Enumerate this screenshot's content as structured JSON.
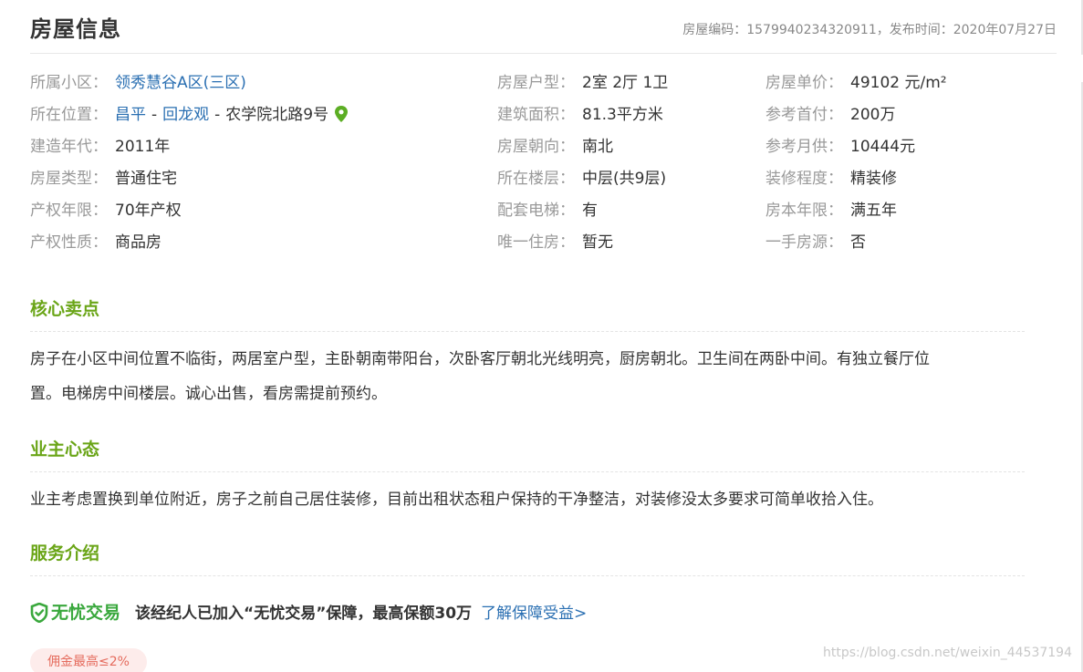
{
  "header": {
    "title": "房屋信息",
    "code_label": "房屋编码：",
    "code_value": "1579940234320911",
    "separator": "，",
    "publish_label": "发布时间：",
    "publish_value": "2020年07月27日"
  },
  "info": {
    "community": {
      "label": "所属小区：",
      "value": "领秀慧谷A区(三区)"
    },
    "location": {
      "label": "所在位置：",
      "district": "昌平",
      "area": "回龙观",
      "dash": "-",
      "address": "农学院北路9号"
    },
    "build_year": {
      "label": "建造年代：",
      "value": "2011年"
    },
    "house_type": {
      "label": "房屋类型：",
      "value": "普通住宅"
    },
    "property_term": {
      "label": "产权年限：",
      "value": "70年产权"
    },
    "property_nature": {
      "label": "产权性质：",
      "value": "商品房"
    },
    "layout": {
      "label": "房屋户型：",
      "value": "2室 2厅 1卫"
    },
    "area_size": {
      "label": "建筑面积：",
      "value": "81.3平方米"
    },
    "orientation": {
      "label": "房屋朝向：",
      "value": "南北"
    },
    "floor": {
      "label": "所在楼层：",
      "value": "中层(共9层)"
    },
    "elevator": {
      "label": "配套电梯：",
      "value": "有"
    },
    "only_house": {
      "label": "唯一住房：",
      "value": "暂无"
    },
    "unit_price": {
      "label": "房屋单价：",
      "value": "49102 元/m²"
    },
    "down_payment": {
      "label": "参考首付：",
      "value": "200万"
    },
    "monthly_payment": {
      "label": "参考月供：",
      "value": "10444元"
    },
    "decoration": {
      "label": "装修程度：",
      "value": "精装修"
    },
    "ownership_years": {
      "label": "房本年限：",
      "value": "满五年"
    },
    "first_hand": {
      "label": "一手房源：",
      "value": "否"
    }
  },
  "sections": {
    "selling_points": {
      "title": "核心卖点",
      "line1": "房子在小区中间位置不临街，两居室户型，主卧朝南带阳台，次卧客厅朝北光线明亮，厨房朝北。卫生间在两卧中间。有独立餐厅位",
      "line2": "置。电梯房中间楼层。诚心出售，看房需提前预约。"
    },
    "owner_mindset": {
      "title": "业主心态",
      "text": "业主考虑置换到单位附近，房子之前自己居住装修，目前出租状态租户保持的干净整洁，对装修没太多要求可简单收拾入住。"
    },
    "service": {
      "title": "服务介绍",
      "brand": "无忧交易",
      "description": "该经纪人已加入“无忧交易”保障，最高保额30万",
      "link": "了解保障受益>",
      "badge": "佣金最高≤2%"
    }
  },
  "watermark": "https://blog.csdn.net/weixin_44537194",
  "colors": {
    "accent_green": "#6aa517",
    "brand_green": "#3aa83d",
    "link_blue": "#2a6fb2",
    "badge_bg": "#fdeceb",
    "badge_text": "#e56b5d",
    "label_gray": "#999999"
  },
  "icons": {
    "location": "map-pin-icon",
    "service": "shield-check-icon"
  }
}
